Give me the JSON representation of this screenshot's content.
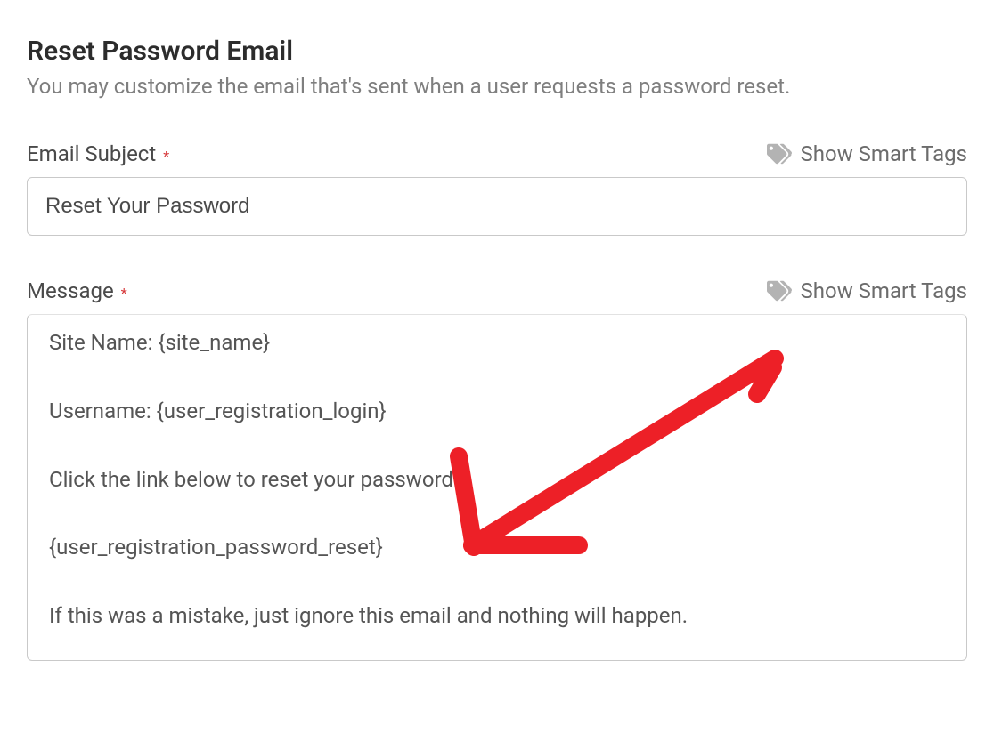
{
  "section": {
    "title": "Reset Password Email",
    "description": "You may customize the email that's sent when a user requests a password reset."
  },
  "subject": {
    "label": "Email Subject",
    "required_mark": "*",
    "value": "Reset Your Password",
    "smart_tags_label": "Show Smart Tags"
  },
  "message": {
    "label": "Message",
    "required_mark": "*",
    "smart_tags_label": "Show Smart Tags",
    "value": "Site Name: {site_name}\n\nUsername: {user_registration_login}\n\nClick the link below to reset your password.\n\n{user_registration_password_reset}\n\nIf this was a mistake, just ignore this email and nothing will happen.\n"
  }
}
